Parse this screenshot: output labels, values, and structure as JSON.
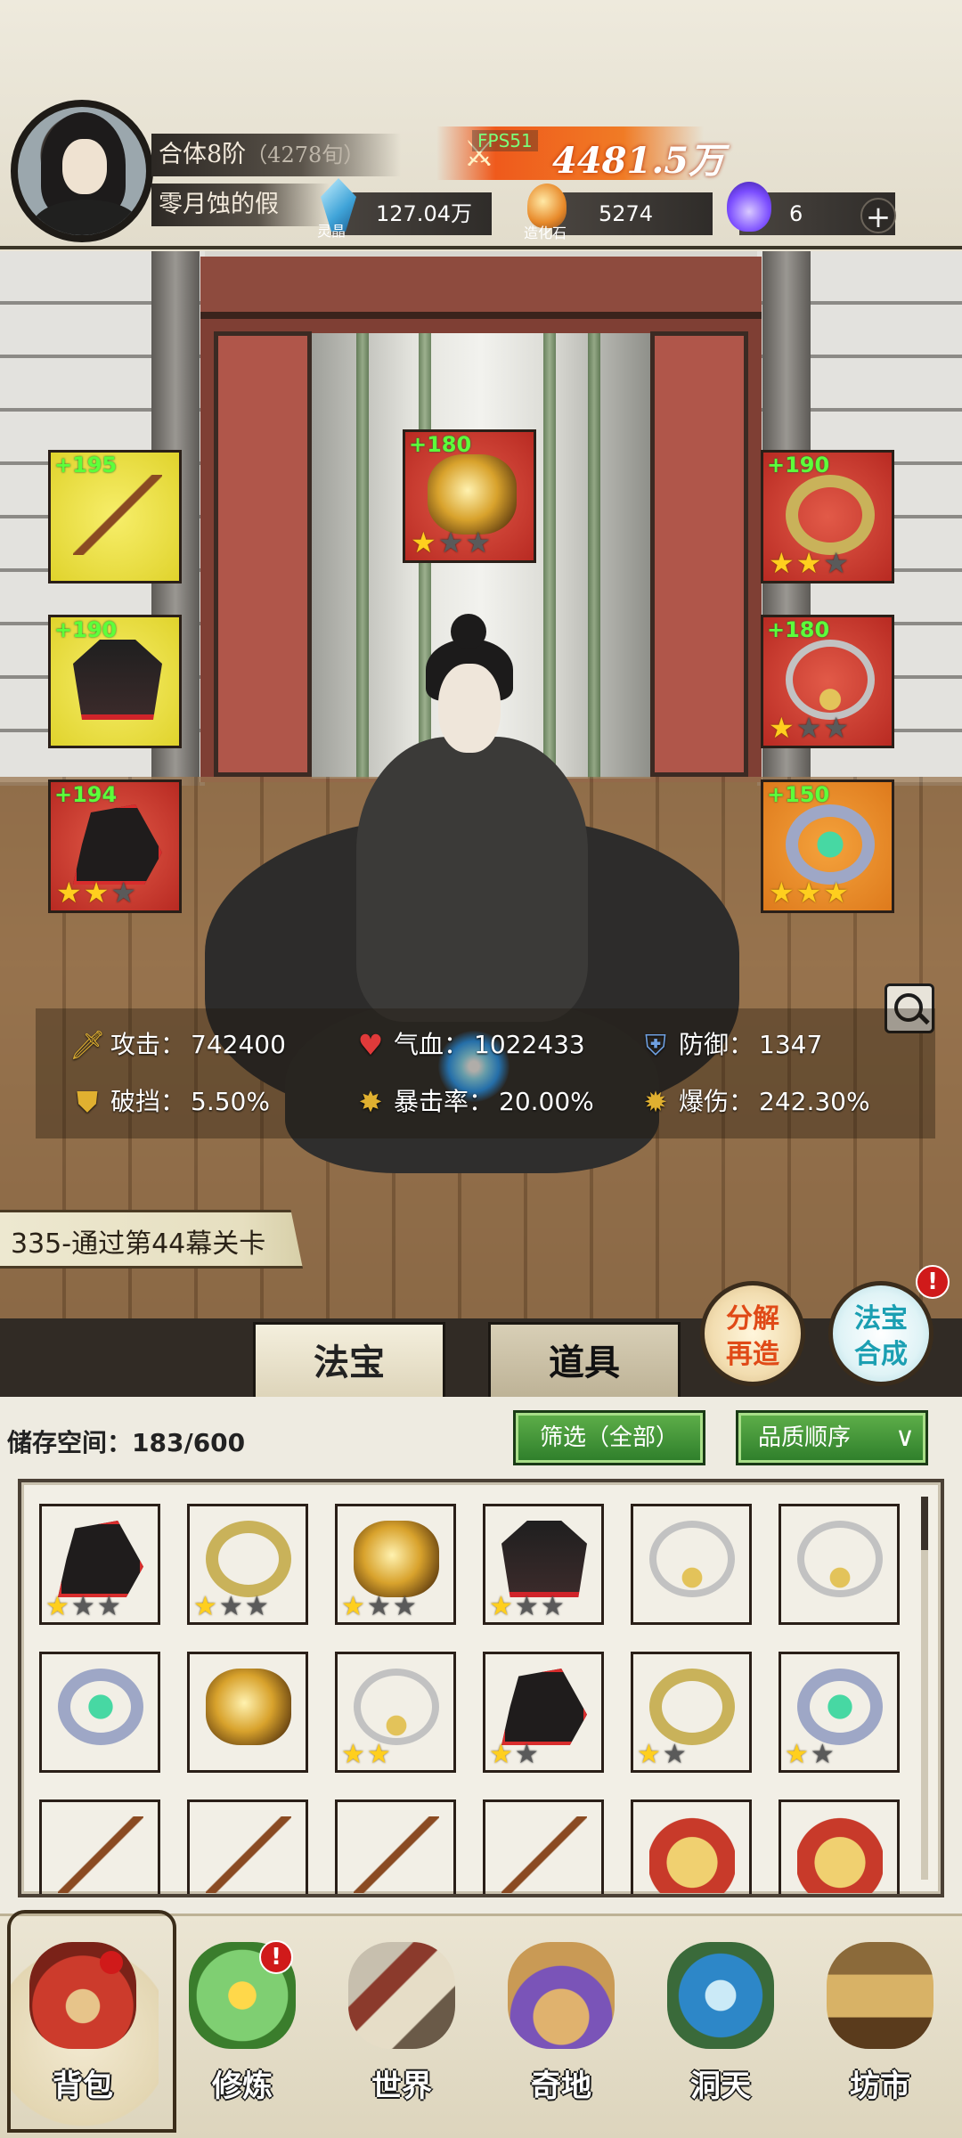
{
  "header": {
    "realm": "合体8阶",
    "realm_rank": "（4278旬）",
    "player_name": "零月蚀的假",
    "fps_label": "FPS51",
    "power_value": "4481.5万",
    "resources": [
      {
        "name": "灵晶",
        "value": "127.04万",
        "icon": "crystal-icon",
        "color": "#3fa3d8"
      },
      {
        "name": "造化石",
        "value": "5274",
        "icon": "ore-icon",
        "color": "#e88a2a"
      },
      {
        "name": "",
        "value": "6",
        "icon": "purple-flame-icon",
        "color": "#7b4dff"
      }
    ]
  },
  "equipment": {
    "left": [
      {
        "bonus": "+195",
        "quality": "yellow",
        "item": "sword",
        "stars": 0
      },
      {
        "bonus": "+190",
        "quality": "yellow",
        "item": "robe",
        "stars": 0
      },
      {
        "bonus": "+194",
        "quality": "red",
        "item": "boots",
        "stars": 2
      }
    ],
    "center": {
      "bonus": "+180",
      "quality": "red",
      "item": "dragon-charm",
      "stars": 1
    },
    "right": [
      {
        "bonus": "+190",
        "quality": "red",
        "item": "crown-ring",
        "stars": 2
      },
      {
        "bonus": "+180",
        "quality": "red",
        "item": "necklace",
        "stars": 1
      },
      {
        "bonus": "+150",
        "quality": "orange",
        "item": "gem-ring",
        "stars": 3
      }
    ],
    "star_max": 3
  },
  "stats": {
    "attack": {
      "label": "攻击：",
      "value": "742400"
    },
    "hp": {
      "label": "气血：",
      "value": "1022433"
    },
    "defense": {
      "label": "防御：",
      "value": "1347"
    },
    "break_block": {
      "label": "破挡：",
      "value": "5.50%"
    },
    "crit_rate": {
      "label": "暴击率：",
      "value": "20.00%"
    },
    "crit_damage": {
      "label": "爆伤：",
      "value": "242.30%"
    }
  },
  "quest": {
    "text": "335-通过第44幕关卡"
  },
  "actions": {
    "decompose": "分解\n再造",
    "decompose_line1": "分解",
    "decompose_line2": "再造",
    "synth_line1": "法宝",
    "synth_line2": "合成",
    "synth_badge": "!"
  },
  "tabs": [
    {
      "label": "法宝",
      "active": true
    },
    {
      "label": "道具",
      "active": false
    }
  ],
  "inventory": {
    "storage_label": "储存空间：",
    "storage_value": "183/600",
    "filter_label": "筛选（全部）",
    "sort_label": "品质顺序",
    "items": [
      {
        "quality": "orange",
        "item": "boots",
        "stars": 1
      },
      {
        "quality": "orange",
        "item": "crown-ring",
        "stars": 1
      },
      {
        "quality": "orange",
        "item": "dragon-charm",
        "stars": 1
      },
      {
        "quality": "orange",
        "item": "robe",
        "stars": 1
      },
      {
        "quality": "orange",
        "item": "necklace",
        "stars": 0
      },
      {
        "quality": "orange",
        "item": "necklace",
        "stars": 0
      },
      {
        "quality": "orange",
        "item": "gem-ring",
        "stars": 0
      },
      {
        "quality": "orange",
        "item": "dragon-charm",
        "stars": 0
      },
      {
        "quality": "purple",
        "item": "necklace",
        "stars": 2,
        "star_max": 2
      },
      {
        "quality": "purple",
        "item": "boots",
        "stars": 1,
        "star_max": 2
      },
      {
        "quality": "purple",
        "item": "crown-ring",
        "stars": 1,
        "star_max": 2
      },
      {
        "quality": "purple",
        "item": "gem-ring",
        "stars": 1,
        "star_max": 2
      },
      {
        "quality": "purple",
        "item": "sword",
        "stars": 0
      },
      {
        "quality": "purple",
        "item": "sword",
        "stars": 0
      },
      {
        "quality": "purple",
        "item": "sword",
        "stars": 0
      },
      {
        "quality": "purple",
        "item": "sword",
        "stars": 0
      },
      {
        "quality": "purple",
        "item": "crown",
        "stars": 0
      },
      {
        "quality": "purple",
        "item": "armor",
        "stars": 0
      }
    ]
  },
  "nav": [
    {
      "label": "背包",
      "icon": "bag-icon",
      "active": true,
      "badge": ""
    },
    {
      "label": "修炼",
      "icon": "lotus-icon",
      "active": false,
      "badge": "!"
    },
    {
      "label": "世界",
      "icon": "scroll-icon",
      "active": false,
      "badge": ""
    },
    {
      "label": "奇地",
      "icon": "temple-icon",
      "active": false,
      "badge": ""
    },
    {
      "label": "洞天",
      "icon": "portal-icon",
      "active": false,
      "badge": ""
    },
    {
      "label": "坊市",
      "icon": "shop-icon",
      "active": false,
      "badge": ""
    }
  ]
}
